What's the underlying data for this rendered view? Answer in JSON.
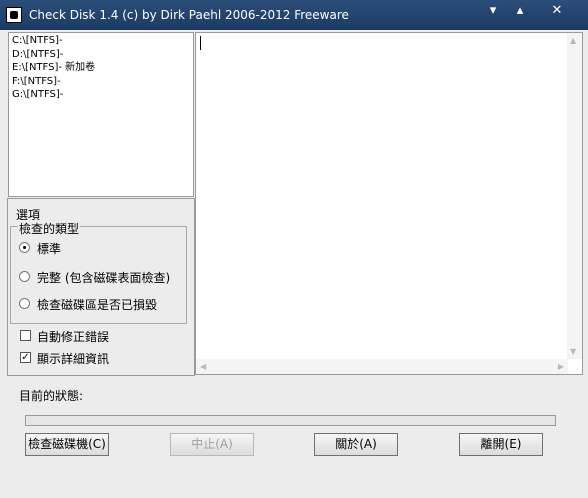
{
  "window": {
    "title": "Check Disk 1.4  (c) by Dirk Paehl  2006-2012 Freeware",
    "minimize": "▾",
    "maximize": "▴",
    "close": "✕"
  },
  "drives": [
    "C:\\[NTFS]-",
    "D:\\[NTFS]-",
    "E:\\[NTFS]- 新加卷",
    "F:\\[NTFS]-",
    "G:\\[NTFS]-"
  ],
  "options": {
    "title": "選項",
    "group_title": "檢查的類型",
    "radios": [
      {
        "label": "標準",
        "checked": true
      },
      {
        "label": "完整 (包含磁碟表面檢查)",
        "checked": false
      },
      {
        "label": "檢查磁碟區是否已損毀",
        "checked": false
      }
    ],
    "checks": [
      {
        "label": "自動修正錯誤",
        "checked": false
      },
      {
        "label": "顯示詳細資訊",
        "checked": true
      }
    ]
  },
  "status": {
    "label": "目前的狀態:",
    "progress": 0
  },
  "buttons": {
    "check": "檢查磁碟機(C)",
    "stop": "中止(A)",
    "about": "關於(A)",
    "exit": "離開(E)"
  }
}
